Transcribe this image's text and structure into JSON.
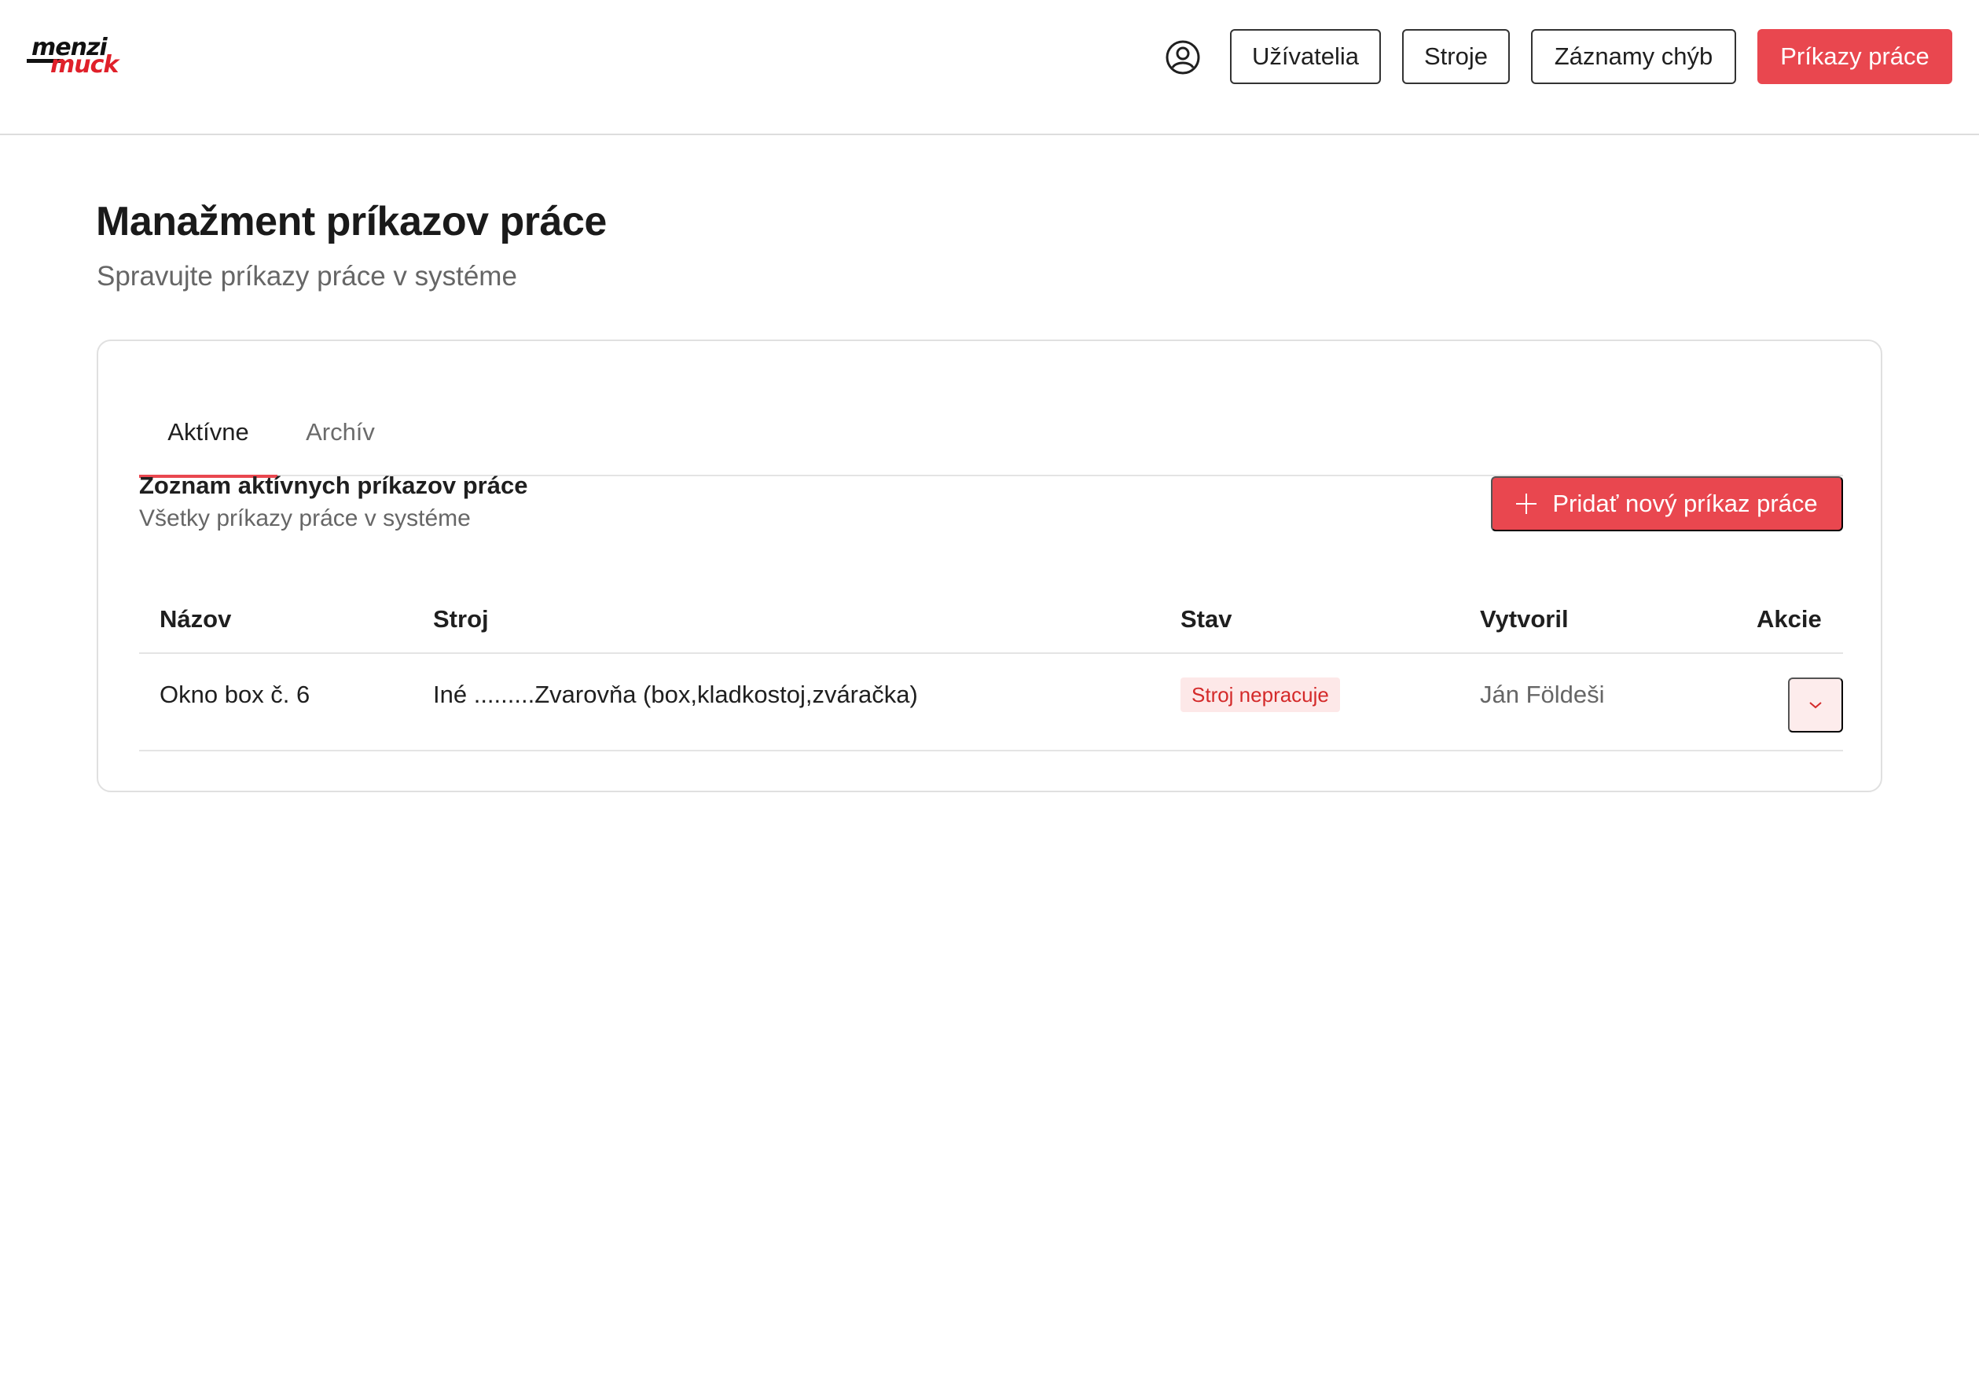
{
  "header": {
    "logo_top": "menzi",
    "logo_bottom": "muck",
    "nav": [
      {
        "label": "Užívatelia",
        "active": false
      },
      {
        "label": "Stroje",
        "active": false
      },
      {
        "label": "Záznamy chýb",
        "active": false
      },
      {
        "label": "Príkazy práce",
        "active": true
      }
    ],
    "user_icon": "user-circle-icon"
  },
  "page": {
    "title": "Manažment príkazov práce",
    "subtitle": "Spravujte príkazy práce v systéme"
  },
  "tabs": [
    {
      "label": "Aktívne",
      "active": true
    },
    {
      "label": "Archív",
      "active": false
    }
  ],
  "list": {
    "title": "Zoznam aktívnych príkazov práce",
    "subtitle": "Všetky príkazy práce v systéme",
    "add_button": "Pridať nový príkaz práce"
  },
  "table": {
    "columns": [
      "Názov",
      "Stroj",
      "Stav",
      "Vytvoril",
      "Akcie"
    ],
    "rows": [
      {
        "name": "Okno box č. 6",
        "machine": "Iné .........Zvarovňa (box,kladkostoj,zváračka)",
        "status": "Stroj nepracuje",
        "created_by": "Ján Földeši"
      }
    ]
  },
  "colors": {
    "accent": "#e9474f",
    "badge_bg": "#fde8e8",
    "badge_text": "#d42a2a"
  }
}
